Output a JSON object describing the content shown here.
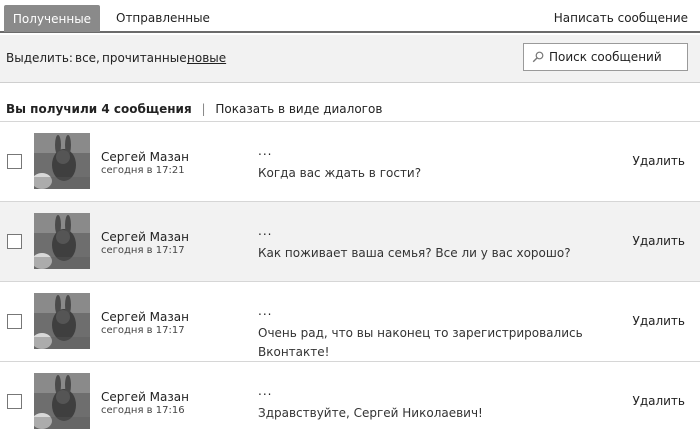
{
  "tabs": {
    "received": "Полученные",
    "sent": "Отправленные",
    "compose": "Написать сообщение"
  },
  "filter": {
    "label": "Выделить:",
    "all": "все,",
    "read": "прочитанные,",
    "new": "новые"
  },
  "search": {
    "placeholder": "Поиск сообщений"
  },
  "summary": {
    "count_text": "Вы получили 4 сообщения",
    "separator": "|",
    "dialogs_link": "Показать в виде диалогов"
  },
  "messages": [
    {
      "sender": "Сергей Мазан",
      "time": "сегодня в 17:21",
      "preview": "...",
      "text": "Когда вас ждать в гости?",
      "delete": "Удалить"
    },
    {
      "sender": "Сергей Мазан",
      "time": "сегодня в 17:17",
      "preview": "...",
      "text": "Как поживает ваша семья? Все ли у вас хорошо?",
      "delete": "Удалить"
    },
    {
      "sender": "Сергей Мазан",
      "time": "сегодня в 17:17",
      "preview": "...",
      "text": "Очень рад, что вы наконец то зарегистрировались Вконтакте!",
      "delete": "Удалить"
    },
    {
      "sender": "Сергей Мазан",
      "time": "сегодня в 17:16",
      "preview": "...",
      "text": "Здравствуйте, Сергей Николаевич!",
      "delete": "Удалить"
    }
  ]
}
